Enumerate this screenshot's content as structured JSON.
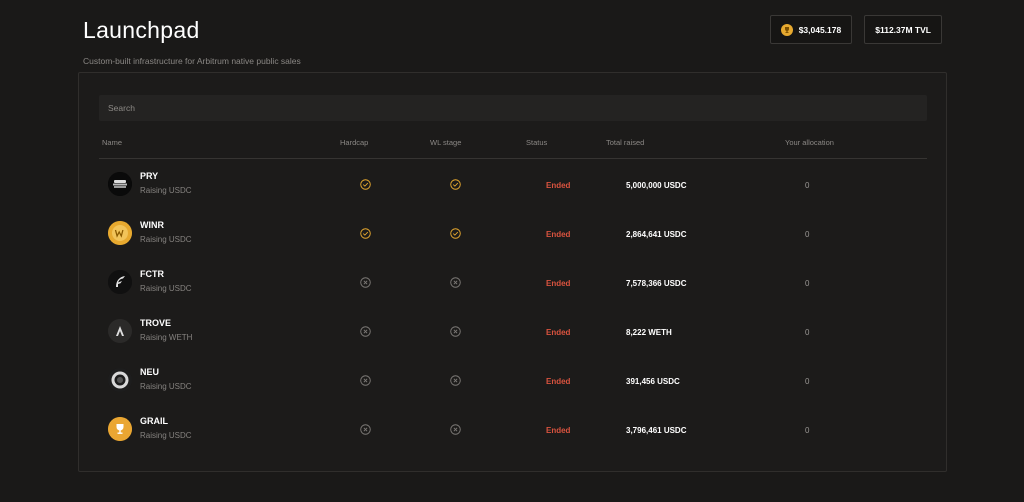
{
  "header": {
    "title": "Launchpad",
    "subtitle": "Custom-built infrastructure for Arbitrum native public sales"
  },
  "stats": {
    "price": "$3,045.178",
    "tvl": "$112.37M TVL"
  },
  "search": {
    "placeholder": "Search"
  },
  "columns": {
    "name": "Name",
    "hardcap": "Hardcap",
    "wl_stage": "WL stage",
    "status": "Status",
    "total_raised": "Total raised",
    "your_allocation": "Your allocation"
  },
  "colors": {
    "accent_gold": "#e7a92f",
    "status_ended": "#d9533f"
  },
  "rows": [
    {
      "name": "PRY",
      "sub": "Raising USDC",
      "hardcap": "check-icon",
      "wl": "check-icon",
      "status": "Ended",
      "raised": "5,000,000 USDC",
      "allocation": "0"
    },
    {
      "name": "WINR",
      "sub": "Raising USDC",
      "hardcap": "check-icon",
      "wl": "check-icon",
      "status": "Ended",
      "raised": "2,864,641 USDC",
      "allocation": "0"
    },
    {
      "name": "FCTR",
      "sub": "Raising USDC",
      "hardcap": "x-circle-icon",
      "wl": "x-circle-icon",
      "status": "Ended",
      "raised": "7,578,366 USDC",
      "allocation": "0"
    },
    {
      "name": "TROVE",
      "sub": "Raising WETH",
      "hardcap": "x-circle-icon",
      "wl": "x-circle-icon",
      "status": "Ended",
      "raised": "8,222 WETH",
      "allocation": "0"
    },
    {
      "name": "NEU",
      "sub": "Raising USDC",
      "hardcap": "x-circle-icon",
      "wl": "x-circle-icon",
      "status": "Ended",
      "raised": "391,456 USDC",
      "allocation": "0"
    },
    {
      "name": "GRAIL",
      "sub": "Raising USDC",
      "hardcap": "x-circle-icon",
      "wl": "x-circle-icon",
      "status": "Ended",
      "raised": "3,796,461 USDC",
      "allocation": "0"
    }
  ]
}
